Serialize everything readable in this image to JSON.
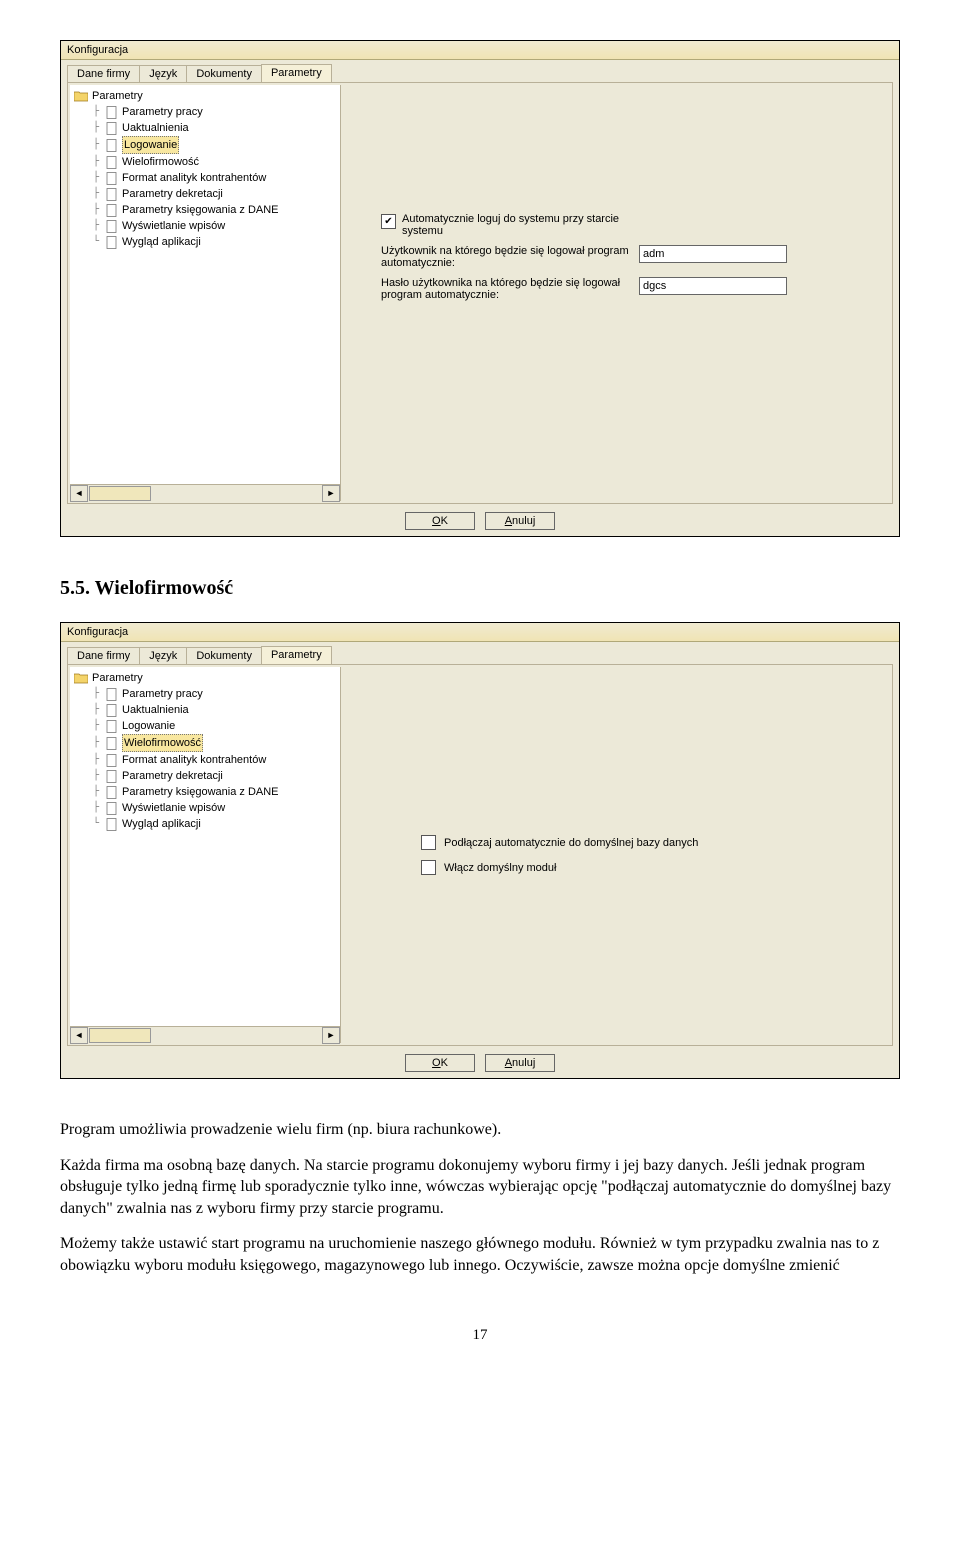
{
  "dialog1": {
    "title": "Konfiguracja",
    "tabs": [
      "Dane firmy",
      "Język",
      "Dokumenty",
      "Parametry"
    ],
    "activeTab": 3,
    "treeRoot": "Parametry",
    "treeItems": [
      "Parametry pracy",
      "Uaktualnienia",
      "Logowanie",
      "Wielofirmowość",
      "Format analityk kontrahentów",
      "Parametry dekretacji",
      "Parametry księgowania z DANE",
      "Wyświetlanie wpisów",
      "Wygląd aplikacji"
    ],
    "selectedIndex": 2,
    "autoLoginLabel": "Automatycznie loguj do systemu przy starcie systemu",
    "userLabel": "Użytkownik na którego będzie się logował program automatycznie:",
    "userValue": "adm",
    "passLabel": "Hasło użytkownika na którego będzie się logował program automatycznie:",
    "passValue": "dgcs",
    "okLabel": "OK",
    "cancelLabel": "Anuluj"
  },
  "heading": "5.5. Wielofirmowość",
  "dialog2": {
    "title": "Konfiguracja",
    "tabs": [
      "Dane firmy",
      "Język",
      "Dokumenty",
      "Parametry"
    ],
    "activeTab": 3,
    "treeRoot": "Parametry",
    "treeItems": [
      "Parametry pracy",
      "Uaktualnienia",
      "Logowanie",
      "Wielofirmowość",
      "Format analityk kontrahentów",
      "Parametry dekretacji",
      "Parametry księgowania z DANE",
      "Wyświetlanie wpisów",
      "Wygląd aplikacji"
    ],
    "selectedIndex": 3,
    "cb1Label": "Podłączaj automatycznie do domyślnej bazy danych",
    "cb2Label": "Włącz domyślny moduł",
    "okLabel": "OK",
    "cancelLabel": "Anuluj"
  },
  "body1": "Program umożliwia prowadzenie wielu firm (np. biura rachunkowe).",
  "body2": "Każda firma ma osobną bazę danych. Na starcie programu dokonujemy wyboru firmy i jej bazy danych. Jeśli jednak program obsługuje tylko jedną firmę lub sporadycznie tylko inne, wówczas wybierając opcję \"podłączaj automatycznie do domyślnej bazy danych\" zwalnia nas z wyboru firmy przy starcie programu.",
  "body3": "Możemy także ustawić start programu na uruchomienie naszego głównego modułu. Również w tym przypadku zwalnia nas to z obowiązku wyboru modułu księgowego, magazynowego lub innego. Oczywiście, zawsze można opcje domyślne zmienić",
  "pageNumber": "17"
}
